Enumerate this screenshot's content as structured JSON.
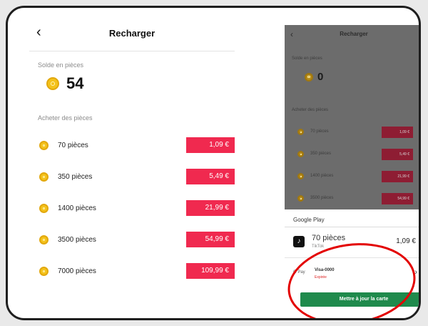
{
  "left": {
    "back_glyph": "‹",
    "title": "Recharger",
    "balance_label": "Solde en pièces",
    "balance_value": "54",
    "buy_label": "Acheter des pièces",
    "packages": [
      {
        "name": "70 pièces",
        "price": "1,09 €"
      },
      {
        "name": "350 pièces",
        "price": "5,49 €"
      },
      {
        "name": "1400 pièces",
        "price": "21,99 €"
      },
      {
        "name": "3500 pièces",
        "price": "54,99 €"
      },
      {
        "name": "7000 pièces",
        "price": "109,99 €"
      }
    ]
  },
  "right": {
    "back_glyph": "‹",
    "title": "Recharger",
    "balance_label": "Solde en pièces",
    "balance_value": "0",
    "buy_label": "Acheter des pièces",
    "packages": [
      {
        "name": "70 pièces",
        "price": "1,09 €"
      },
      {
        "name": "350 pièces",
        "price": "5,49 €"
      },
      {
        "name": "1400 pièces",
        "price": "21,99 €"
      },
      {
        "name": "3500 pièces",
        "price": "54,99 €"
      }
    ],
    "google_play_label": "Google Play",
    "item_title": "70 pièces",
    "item_sub": "TikTok",
    "item_price": "1,09 €",
    "gpay_label": "G Pay",
    "card_label": "Visa-0000",
    "card_status": "Expirée",
    "chevron": "›",
    "update_button": "Mettre à jour la carte"
  },
  "colors": {
    "price_red": "#f0294f",
    "coin_gold": "#f4c21b",
    "update_green": "#1f8a4c",
    "annotation_red": "#e30000"
  },
  "icons": [
    "back-arrow-icon",
    "coin-icon",
    "tiktok-icon",
    "google-pay-icon",
    "chevron-right-icon"
  ]
}
